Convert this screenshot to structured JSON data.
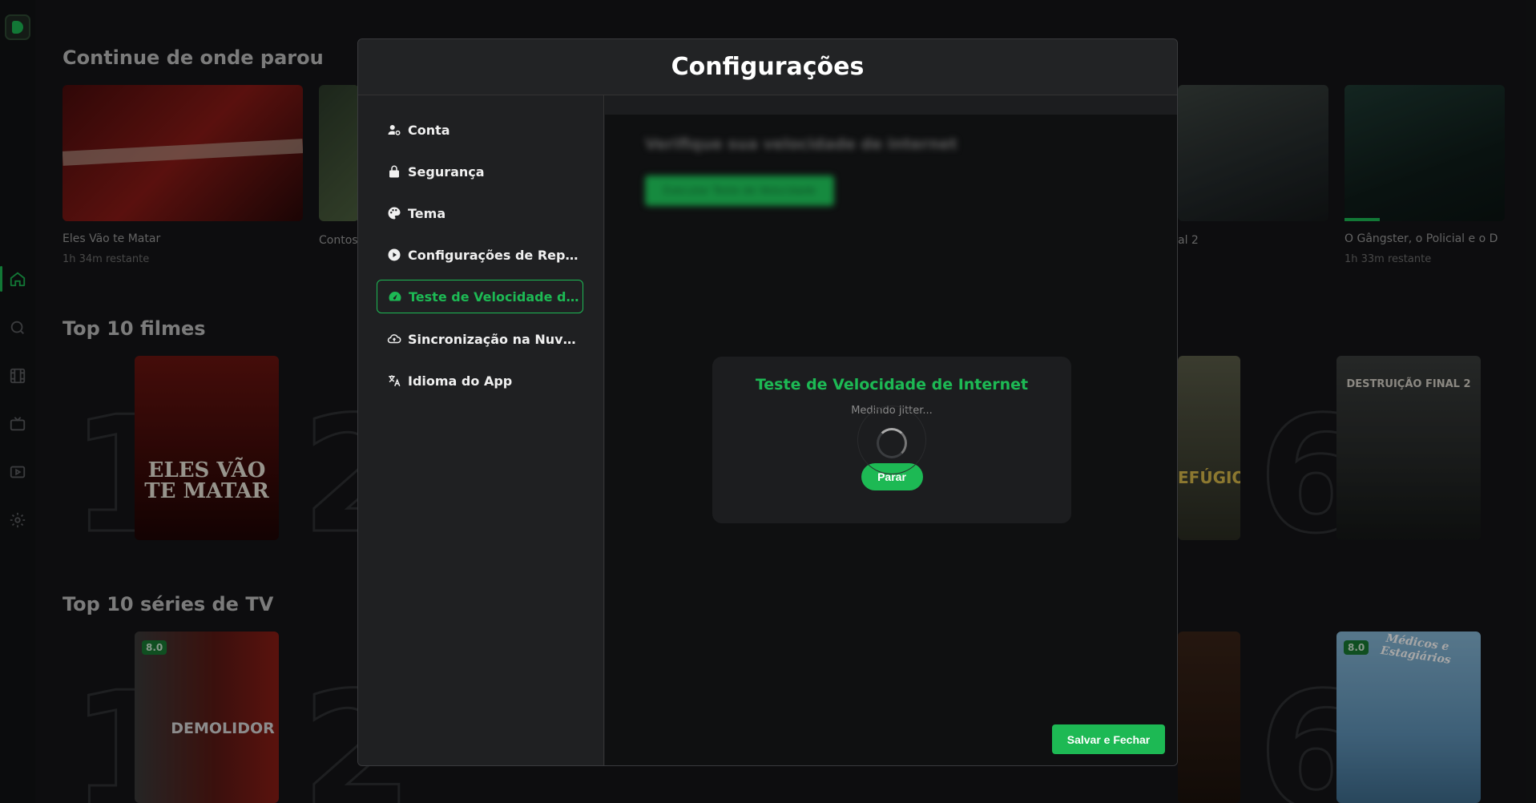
{
  "background": {
    "continue_watching": {
      "title": "Continue de onde parou",
      "items": [
        {
          "title": "Eles Vão te Matar",
          "remaining": "1h 34m restante",
          "progress": 0.0
        },
        {
          "title": "Contos",
          "remaining": ""
        },
        {
          "title": "al 2",
          "remaining": ""
        },
        {
          "title": "O Gângster, o Policial e o D",
          "remaining": "1h 33m restante",
          "progress": 0.35
        }
      ]
    },
    "top_movies": {
      "title": "Top 10 filmes",
      "ranks": [
        "1",
        "2",
        "6"
      ],
      "poster_1_text": "ELES VÃO TE MATAR",
      "poster_5_text": "EFÚGIO",
      "poster_6_text": "DESTRUIÇÃO FINAL 2"
    },
    "top_series": {
      "title": "Top 10 séries de TV",
      "ranks": [
        "1",
        "2",
        "6"
      ],
      "poster_1_rating": "8.0",
      "poster_1_text": "DEMOLIDOR",
      "poster_6_rating": "8.0",
      "poster_6_text": "Médicos e Estagiários"
    }
  },
  "modal": {
    "title": "Configurações",
    "nav": [
      {
        "icon": "user-gear-icon",
        "label": "Conta"
      },
      {
        "icon": "lock-icon",
        "label": "Segurança"
      },
      {
        "icon": "palette-icon",
        "label": "Tema"
      },
      {
        "icon": "play-circle-icon",
        "label": "Configurações de Repro..."
      },
      {
        "icon": "gauge-icon",
        "label": "Teste de Velocidade de ...",
        "active": true
      },
      {
        "icon": "cloud-sync-icon",
        "label": "Sincronização na Nuvem"
      },
      {
        "icon": "translate-icon",
        "label": "Idioma do App"
      }
    ],
    "content": {
      "blurred_heading": "Verifique sua velocidade de internet",
      "blurred_button": "Executar Teste de Velocidade",
      "speed_card": {
        "title": "Teste de Velocidade de Internet",
        "status": "Medindo jitter...",
        "stop_label": "Parar"
      }
    },
    "save_label": "Salvar e Fechar"
  },
  "colors": {
    "accent": "#1db954",
    "modal_bg": "#1a1b1d",
    "page_bg": "#141517"
  }
}
